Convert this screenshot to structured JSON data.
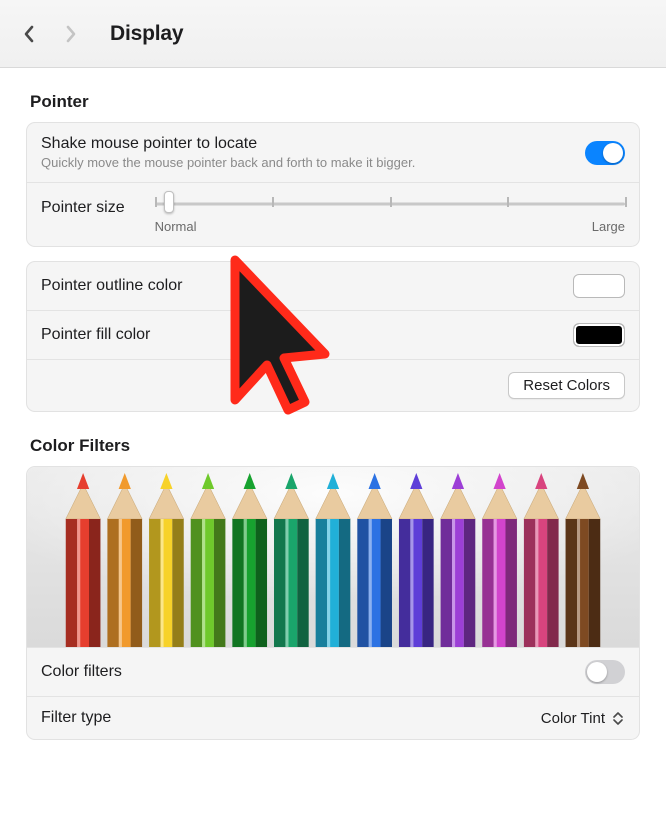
{
  "header": {
    "title": "Display"
  },
  "pointer": {
    "heading": "Pointer",
    "shake": {
      "label": "Shake mouse pointer to locate",
      "sublabel": "Quickly move the mouse pointer back and forth to make it bigger.",
      "on": true
    },
    "size": {
      "label": "Pointer size",
      "min_label": "Normal",
      "max_label": "Large",
      "value_pct": 3
    },
    "outline": {
      "label": "Pointer outline color",
      "swatch": "white"
    },
    "fill": {
      "label": "Pointer fill color",
      "swatch": "black"
    },
    "reset_label": "Reset Colors"
  },
  "color_filters": {
    "heading": "Color Filters",
    "pencil_colors": [
      "#e63e2e",
      "#f19a2d",
      "#f7d229",
      "#6fc92b",
      "#17a22f",
      "#1aa56b",
      "#21b0d8",
      "#2c72e3",
      "#5e3ed8",
      "#9c3fd6",
      "#d244cc",
      "#d8447e",
      "#7e4a22"
    ],
    "toggle": {
      "label": "Color filters",
      "on": false
    },
    "filter_type": {
      "label": "Filter type",
      "value": "Color Tint"
    }
  }
}
